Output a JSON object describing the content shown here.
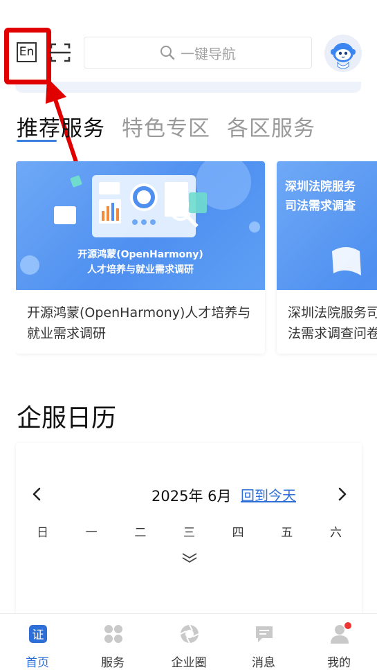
{
  "header": {
    "lang_label": "En",
    "search_placeholder": "一键导航"
  },
  "tabs": [
    {
      "label": "推荐服务",
      "active": true
    },
    {
      "label": "特色专区",
      "active": false
    },
    {
      "label": "各区服务",
      "active": false
    }
  ],
  "cards": [
    {
      "image_caption_line1": "开源鸿蒙(OpenHarmony)",
      "image_caption_line2": "人才培养与就业需求调研",
      "title": "开源鸿蒙(OpenHarmony)人才培养与就业需求调研"
    },
    {
      "image_caption_line1": "深圳法院服务",
      "image_caption_line2": "司法需求调查",
      "title": "深圳法院服务司法需求调查问卷"
    }
  ],
  "calendar": {
    "section_title": "企服日历",
    "month_label": "2025年 6月",
    "today_link": "回到今天",
    "weekdays": [
      "日",
      "一",
      "二",
      "三",
      "四",
      "五",
      "六"
    ]
  },
  "bottom_nav": [
    {
      "label": "首页",
      "icon": "home-icon",
      "active": true
    },
    {
      "label": "服务",
      "icon": "grid-icon",
      "active": false
    },
    {
      "label": "企业圈",
      "icon": "circle-aperture-icon",
      "active": false
    },
    {
      "label": "消息",
      "icon": "message-icon",
      "active": false
    },
    {
      "label": "我的",
      "icon": "user-icon",
      "active": false,
      "badge": true
    }
  ],
  "colors": {
    "accent": "#2d6fd6",
    "highlight_red": "#e10000",
    "card_blue": "#5b9bf3"
  }
}
